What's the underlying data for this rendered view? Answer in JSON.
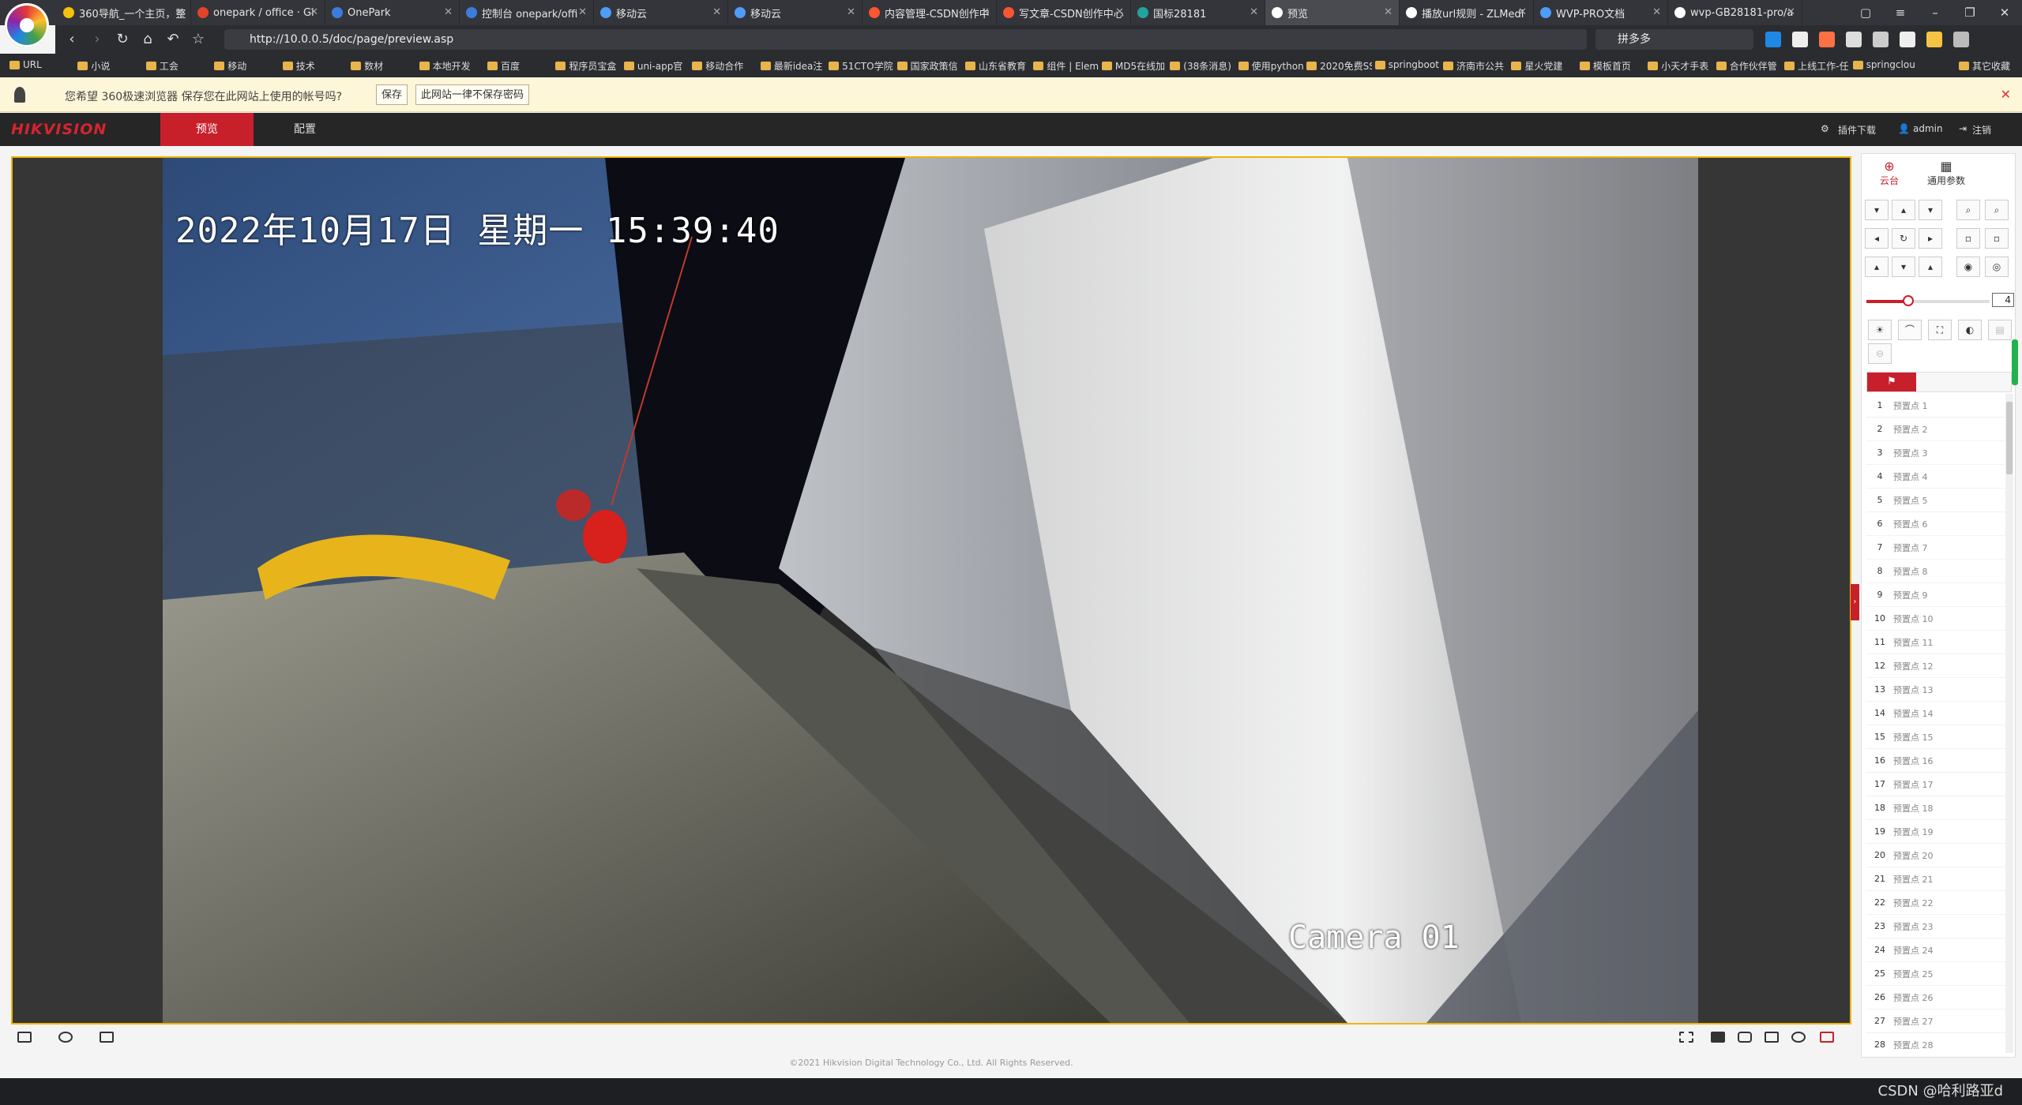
{
  "browser": {
    "tabs": [
      {
        "label": "360导航_一个主页，整",
        "color": "#f4c20d"
      },
      {
        "label": "onepark / office · Gi",
        "color": "#e24329"
      },
      {
        "label": "OnePark",
        "color": "#3b7ddd"
      },
      {
        "label": "控制台 onepark/offi",
        "color": "#3b7ddd"
      },
      {
        "label": "移动云",
        "color": "#4f9cf9"
      },
      {
        "label": "移动云",
        "color": "#4f9cf9"
      },
      {
        "label": "内容管理-CSDN创作中",
        "color": "#fc5531"
      },
      {
        "label": "写文章-CSDN创作中心",
        "color": "#fc5531"
      },
      {
        "label": "国标28181",
        "color": "#21a39e"
      },
      {
        "label": "预览",
        "color": "#ffffff"
      },
      {
        "label": "播放url规则 - ZLMedi",
        "color": "#ffffff"
      },
      {
        "label": "WVP-PRO文档",
        "color": "#4f9cf9"
      },
      {
        "label": "wvp-GB28181-pro/a",
        "color": "#ffffff"
      }
    ],
    "url": "http://10.0.0.5/doc/page/preview.asp",
    "search_text": "拼多多",
    "bookmarks": [
      "URL",
      "小说",
      "工会",
      "移动",
      "技术",
      "数材",
      "本地开发",
      "百度",
      "程序员宝盒",
      "uni-app官",
      "移动合作",
      "最新idea注",
      "51CTO学院",
      "国家政策信",
      "山东省教育",
      "组件 | Elem",
      "MD5在线加",
      "(38条消息)",
      "使用python",
      "2020免费SS",
      "springboot",
      "济南市公共",
      "星火党建",
      "模板首页",
      "小天才手表",
      "合作伙伴管",
      "上线工作-任",
      "springclou",
      "其它收藏"
    ]
  },
  "notify": {
    "message": "您希望 360极速浏览器 保存您在此网站上使用的帐号吗?",
    "save_label": "保存",
    "never_label": "此网站一律不保存密码"
  },
  "hik": {
    "logo": "HIKVISION",
    "nav_preview": "预览",
    "nav_config": "配置",
    "plugin_download": "插件下载",
    "user": "admin",
    "logout": "注销"
  },
  "video": {
    "osd_time": "2022年10月17日 星期一 15:39:40",
    "osd_camera": "Camera 01"
  },
  "ptz": {
    "tab_ptz": "云台",
    "tab_params": "通用参数",
    "speed": "4",
    "speed_fraction": 0.34,
    "presets": [
      "预置点 1",
      "预置点 2",
      "预置点 3",
      "预置点 4",
      "预置点 5",
      "预置点 6",
      "预置点 7",
      "预置点 8",
      "预置点 9",
      "预置点 10",
      "预置点 11",
      "预置点 12",
      "预置点 13",
      "预置点 14",
      "预置点 15",
      "预置点 16",
      "预置点 17",
      "预置点 18",
      "预置点 19",
      "预置点 20",
      "预置点 21",
      "预置点 22",
      "预置点 23",
      "预置点 24",
      "预置点 25",
      "预置点 26",
      "预置点 27",
      "预置点 28"
    ]
  },
  "footer": "©2021 Hikvision Digital Technology Co., Ltd. All Rights Reserved.",
  "watermark": "CSDN @哈利路亚d"
}
